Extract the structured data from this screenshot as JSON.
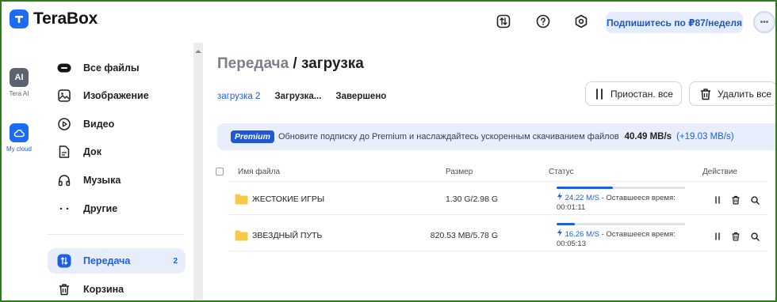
{
  "app": {
    "logo_text": "TeraBox",
    "brand_color": "#1c6bf2",
    "accent_color": "#1c5fe0"
  },
  "header": {
    "icons": [
      "transfer-icon",
      "help-icon",
      "settings-icon"
    ],
    "subscribe_label": "Подпишитесь по ₽87/неделя",
    "avatar_label": "•••"
  },
  "rail": {
    "items": [
      {
        "label": "Tera AI",
        "icon": "ai-icon",
        "badge": "AI"
      },
      {
        "label": "My cloud",
        "icon": "cloud-icon"
      }
    ]
  },
  "sidebar": {
    "items": [
      {
        "label": "Все файлы",
        "icon": "all-files-icon"
      },
      {
        "label": "Изображение",
        "icon": "image-icon"
      },
      {
        "label": "Видео",
        "icon": "video-icon"
      },
      {
        "label": "Док",
        "icon": "document-icon"
      },
      {
        "label": "Музыка",
        "icon": "headphones-icon"
      },
      {
        "label": "Другие",
        "icon": "more-icon"
      }
    ],
    "bottom_items": [
      {
        "label": "Передача",
        "icon": "transfer-icon",
        "count": "2",
        "active": true
      },
      {
        "label": "Корзина",
        "icon": "trash-icon"
      }
    ]
  },
  "main": {
    "title_crumb": "Передача",
    "title_separator": " / ",
    "title_current": "загрузка",
    "tabs": [
      {
        "label": "загрузка 2",
        "active": true
      },
      {
        "label": "Загрузка...",
        "active": false
      },
      {
        "label": "Завершено",
        "active": false
      }
    ],
    "pause_all_label": "Приостан. все",
    "delete_all_label": "Удалить все",
    "premium": {
      "badge": "Premium",
      "message": "Обновите подписку до Premium и наслаждайтесь ускоренным скачиванием файлов",
      "speed": "40.49 MB/s",
      "boost": "(+19.03 MB/s)"
    },
    "table": {
      "columns": [
        "Имя файла",
        "Размер",
        "Статус",
        "Действие"
      ],
      "rows": [
        {
          "name": "ЖЕСТОКИЕ ИГРЫ",
          "size": "1.30 G/2.98 G",
          "progress": 0.44,
          "speed": "24.22 M/S",
          "remaining_label": " - Оставшееся время:",
          "time_left": "00:01:11"
        },
        {
          "name": "ЗВЕЗДНЫЙ ПУТЬ",
          "size": "820.53 MB/5.78 G",
          "progress": 0.14,
          "speed": "16.26 M/S",
          "remaining_label": " - Оставшееся время:",
          "time_left": "00:05:13"
        }
      ],
      "row_actions": [
        "pause-icon",
        "trash-icon",
        "search-icon"
      ]
    }
  }
}
